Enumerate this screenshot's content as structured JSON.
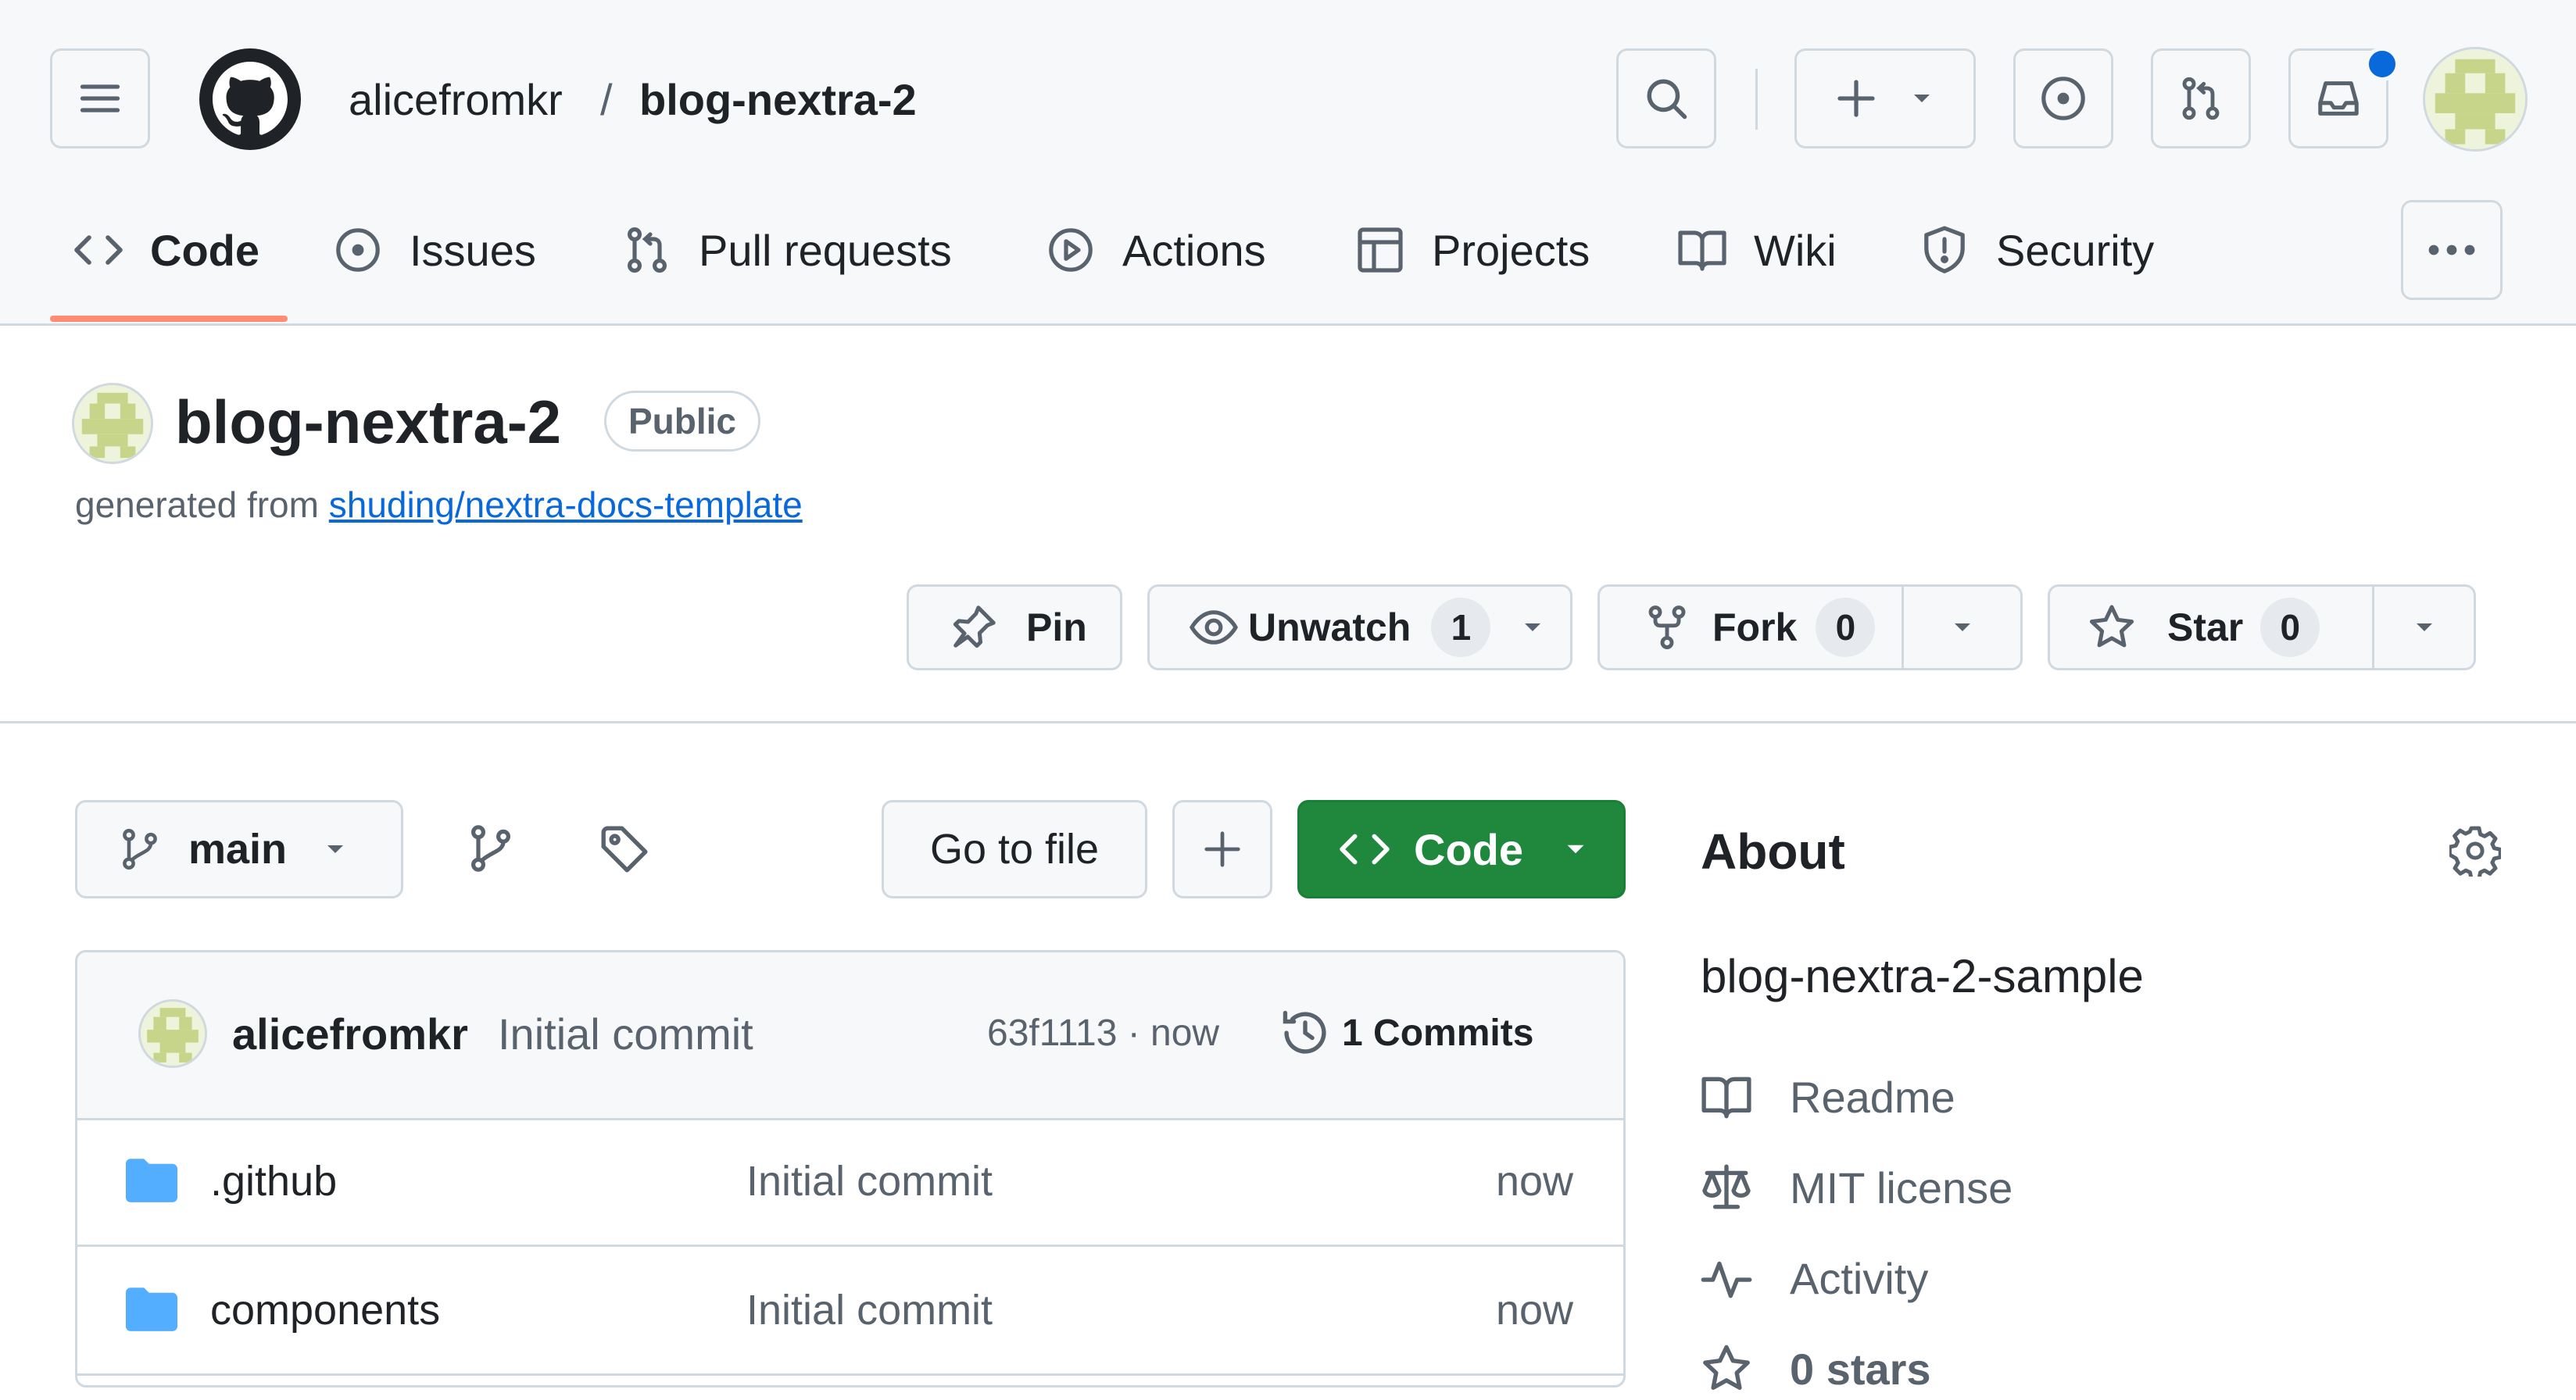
{
  "header": {
    "owner": "alicefromkr",
    "separator": "/",
    "repo": "blog-nextra-2",
    "plus_label": "+"
  },
  "tabs": [
    {
      "label": "Code",
      "icon": "code-icon",
      "selected": true
    },
    {
      "label": "Issues",
      "icon": "issue-opened-icon"
    },
    {
      "label": "Pull requests",
      "icon": "git-pull-request-icon"
    },
    {
      "label": "Actions",
      "icon": "play-icon"
    },
    {
      "label": "Projects",
      "icon": "table-icon"
    },
    {
      "label": "Wiki",
      "icon": "book-icon"
    },
    {
      "label": "Security",
      "icon": "shield-icon"
    }
  ],
  "repo": {
    "title": "blog-nextra-2",
    "visibility": "Public",
    "generated_prefix": "generated from",
    "template_link": "shuding/nextra-docs-template"
  },
  "actions": {
    "pin_label": "Pin",
    "watch_label": "Unwatch",
    "watch_count": "1",
    "fork_label": "Fork",
    "fork_count": "0",
    "star_label": "Star",
    "star_count": "0"
  },
  "filenav": {
    "branch": "main",
    "goto_label": "Go to file",
    "add_label": "+",
    "code_label": "Code"
  },
  "commit": {
    "author": "alicefromkr",
    "message": "Initial commit",
    "meta": "63f1113 · now",
    "commits_label": "1 Commits"
  },
  "files": [
    {
      "name": ".github",
      "message": "Initial commit",
      "age": "now"
    },
    {
      "name": "components",
      "message": "Initial commit",
      "age": "now"
    }
  ],
  "about": {
    "title": "About",
    "description": "blog-nextra-2-sample",
    "items": [
      {
        "label": "Readme",
        "icon": "book-icon"
      },
      {
        "label": "MIT license",
        "icon": "law-icon"
      },
      {
        "label": "Activity",
        "icon": "pulse-icon"
      },
      {
        "label": "0 stars",
        "icon": "star-icon"
      }
    ]
  },
  "colors": {
    "accent_underline": "#fd8c73",
    "primary_green": "#1f883d",
    "link_blue": "#0969da",
    "notification_dot": "#0969da",
    "folder_blue": "#54aeff"
  }
}
